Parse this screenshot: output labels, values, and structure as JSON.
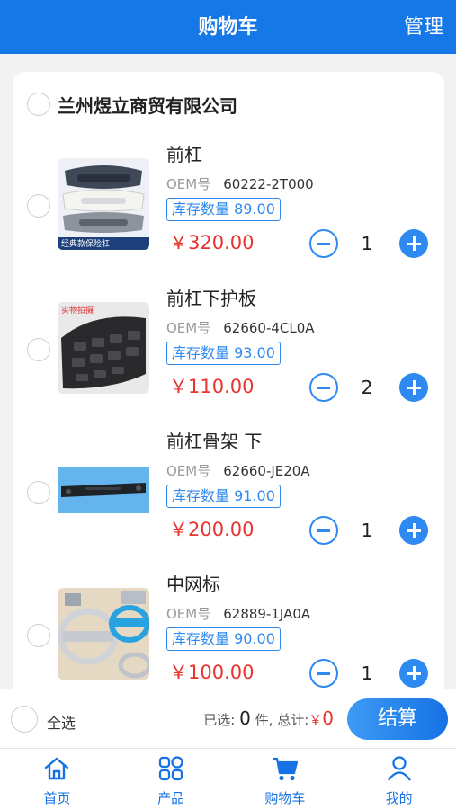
{
  "header": {
    "title": "购物车",
    "manage": "管理"
  },
  "shop": {
    "name": "兰州煜立商贸有限公司"
  },
  "oem_label": "OEM号",
  "stock_label": "库存数量",
  "items": [
    {
      "name": "前杠",
      "oem": "60222-2T000",
      "stock": "89.00",
      "price": "￥320.00",
      "qty": "1",
      "thumb_caption": "经典款保险杠"
    },
    {
      "name": "前杠下护板",
      "oem": "62660-4CL0A",
      "stock": "93.00",
      "price": "￥110.00",
      "qty": "2",
      "thumb_caption": "实物拍摄"
    },
    {
      "name": "前杠骨架 下",
      "oem": "62660-JE20A",
      "stock": "91.00",
      "price": "￥200.00",
      "qty": "1"
    },
    {
      "name": "中网标",
      "oem": "62889-1JA0A",
      "stock": "90.00",
      "price": "￥100.00",
      "qty": "1"
    }
  ],
  "checkout": {
    "select_all": "全选",
    "selected_prefix": "已选:",
    "selected_count": "0",
    "selected_suffix": "件, 总计:",
    "currency": "￥",
    "total": "0",
    "pay_button": "结算"
  },
  "tabs": [
    {
      "label": "首页",
      "icon": "home-icon"
    },
    {
      "label": "产品",
      "icon": "grid-icon"
    },
    {
      "label": "购物车",
      "icon": "cart-icon"
    },
    {
      "label": "我的",
      "icon": "user-icon"
    }
  ],
  "colors": {
    "primary": "#1677e6",
    "price": "#e8332f",
    "accent": "#2e89f0"
  }
}
